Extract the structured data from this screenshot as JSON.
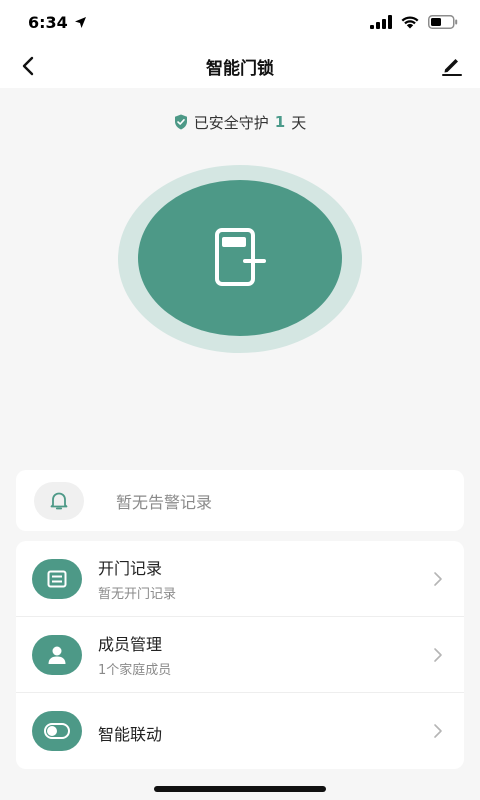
{
  "status_bar": {
    "time": "6:34"
  },
  "nav": {
    "title": "智能门锁"
  },
  "guard": {
    "prefix": "已安全守护",
    "days": "1",
    "suffix": "天"
  },
  "alert": {
    "text": "暂无告警记录"
  },
  "list": [
    {
      "title": "开门记录",
      "subtitle": "暂无开门记录",
      "icon": "record-icon"
    },
    {
      "title": "成员管理",
      "subtitle": "1个家庭成员",
      "icon": "person-icon"
    },
    {
      "title": "智能联动",
      "subtitle": "",
      "icon": "toggle-icon"
    }
  ],
  "colors": {
    "accent": "#4d9987",
    "accent_light": "#d4e6e2",
    "background": "#f6f6f6"
  }
}
